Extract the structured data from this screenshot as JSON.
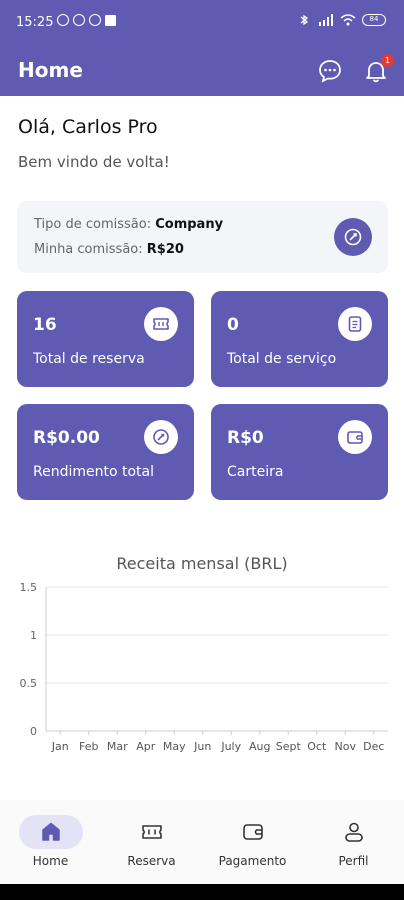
{
  "status_bar": {
    "time": "15:25",
    "battery": "84"
  },
  "app_bar": {
    "title": "Home",
    "chat_icon": "chat-bubble-icon",
    "notification_icon": "bell-icon",
    "notification_count": "1"
  },
  "greeting": {
    "title": "Olá, Carlos Pro",
    "subtitle": "Bem vindo de volta!"
  },
  "commission": {
    "type_label": "Tipo de comissão: ",
    "type_value": "Company",
    "mine_label": "Minha comissão: ",
    "mine_value": "R$20",
    "icon": "gauge-icon"
  },
  "stats": [
    {
      "value": "16",
      "label": "Total de reserva",
      "icon": "ticket-icon"
    },
    {
      "value": "0",
      "label": "Total de serviço",
      "icon": "document-icon"
    },
    {
      "value": "R$0.00",
      "label": "Rendimento total",
      "icon": "gauge-icon"
    },
    {
      "value": "R$0",
      "label": "Carteira",
      "icon": "wallet-icon"
    }
  ],
  "colors": {
    "primary": "#5f5bb3",
    "nav_active_bg": "#e4e3f5"
  },
  "chart_data": {
    "type": "line",
    "title": "Receita mensal (BRL)",
    "categories": [
      "Jan",
      "Feb",
      "Mar",
      "Apr",
      "May",
      "Jun",
      "July",
      "Aug",
      "Sept",
      "Oct",
      "Nov",
      "Dec"
    ],
    "values": [
      0,
      0,
      0,
      0,
      0,
      0,
      0,
      0,
      0,
      0,
      0,
      0
    ],
    "ylim": [
      0,
      1.5
    ],
    "yticks": [
      "0",
      "0.5",
      "1",
      "1.5"
    ],
    "grid": true
  },
  "bottom_nav": [
    {
      "label": "Home",
      "icon": "home-icon",
      "active": true
    },
    {
      "label": "Reserva",
      "icon": "ticket-icon",
      "active": false
    },
    {
      "label": "Pagamento",
      "icon": "wallet-icon",
      "active": false
    },
    {
      "label": "Perfil",
      "icon": "person-icon",
      "active": false
    }
  ]
}
